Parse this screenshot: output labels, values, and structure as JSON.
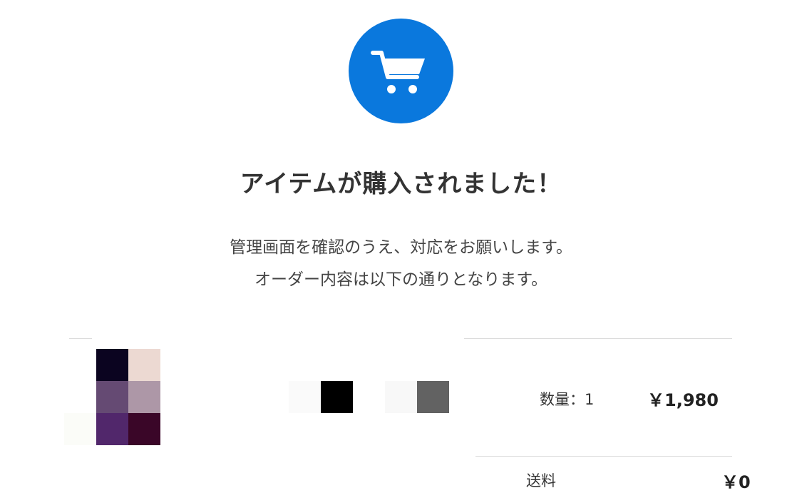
{
  "header": {
    "icon": "shopping-cart-icon",
    "icon_bg_color": "#0a78dd",
    "title": "アイテムが購入されました！"
  },
  "message": {
    "line1": "管理画面を確認のうえ、対応をお願いします。",
    "line2": "オーダー内容は以下の通りとなります。"
  },
  "order_item": {
    "thumbnail_colors": [
      "#ffffff",
      "#0b0420",
      "#ecd9d2",
      "#ffffff",
      "#654a73",
      "#ad97a7",
      "#fbfcf8",
      "#51276b",
      "#3a0628"
    ],
    "option_swatches": [
      {
        "color": "#fafafa"
      },
      {
        "color": "#000000"
      },
      {
        "color": "#f8f8f8"
      },
      {
        "color": "#626262"
      }
    ],
    "quantity_text": "数量：1",
    "price": "￥1,980"
  },
  "shipping": {
    "label": "送料",
    "price": "￥0"
  }
}
